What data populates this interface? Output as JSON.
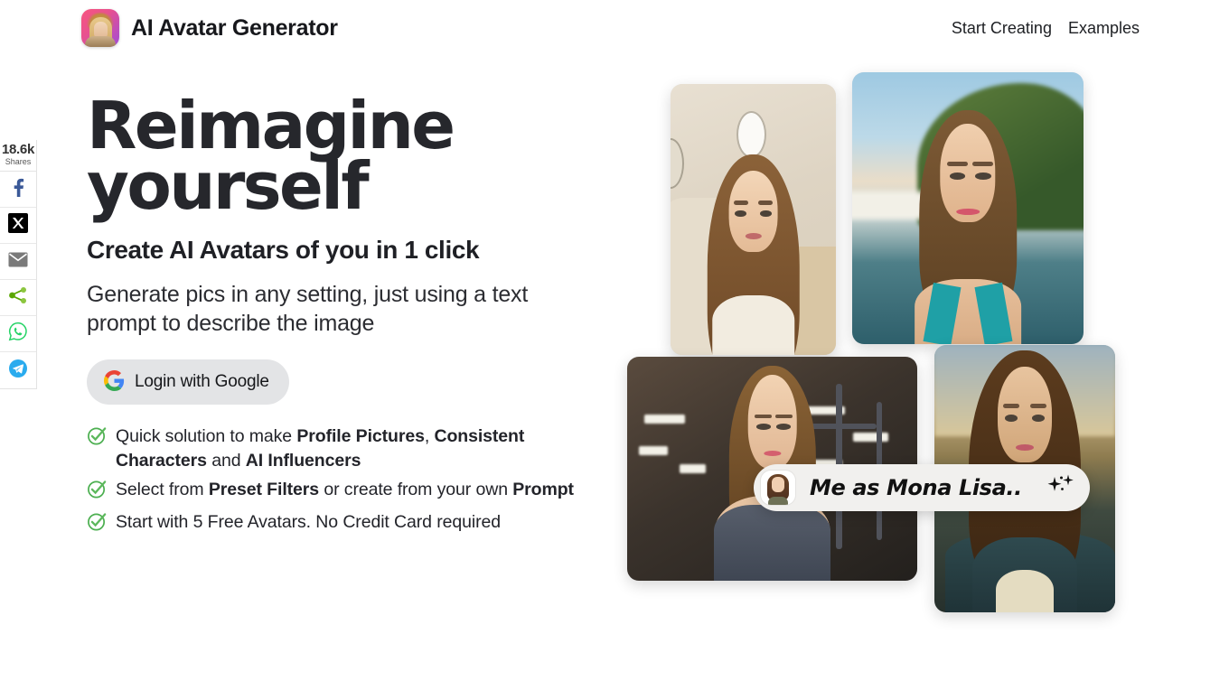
{
  "header": {
    "brand_title": "AI Avatar Generator",
    "logo_icon": "avatar-logo-icon",
    "nav": [
      {
        "label": "Start Creating",
        "name": "nav-start-creating"
      },
      {
        "label": "Examples",
        "name": "nav-examples"
      }
    ]
  },
  "share_rail": {
    "count": "18.6k",
    "count_label": "Shares",
    "buttons": [
      {
        "name": "facebook-icon",
        "label": "Facebook",
        "color": "#3b5998"
      },
      {
        "name": "x-twitter-icon",
        "label": "X",
        "color": "#000000"
      },
      {
        "name": "email-icon",
        "label": "Email",
        "color": "#7a7a7a"
      },
      {
        "name": "share-icon",
        "label": "Share",
        "color": "#7ac143"
      },
      {
        "name": "whatsapp-icon",
        "label": "WhatsApp",
        "color": "#25d366"
      },
      {
        "name": "telegram-icon",
        "label": "Telegram",
        "color": "#2aabee"
      }
    ]
  },
  "hero": {
    "headline": "Reimagine yourself",
    "subheadline": "Create AI Avatars of you in 1 click",
    "description": "Generate pics in any setting, just using a text prompt to describe the image",
    "login_button": {
      "label": "Login with Google",
      "icon": "google-icon"
    },
    "bullets": [
      {
        "icon": "green-check-circle-icon",
        "segments": [
          {
            "text": "Quick solution to make ",
            "bold": false
          },
          {
            "text": "Profile Pictures",
            "bold": true
          },
          {
            "text": ", ",
            "bold": false
          },
          {
            "text": "Consistent Characters",
            "bold": true
          },
          {
            "text": " and ",
            "bold": false
          },
          {
            "text": "AI Influencers",
            "bold": true
          }
        ]
      },
      {
        "icon": "green-check-circle-icon",
        "segments": [
          {
            "text": "Select from ",
            "bold": false
          },
          {
            "text": "Preset Filters",
            "bold": true
          },
          {
            "text": " or create from your own ",
            "bold": false
          },
          {
            "text": "Prompt",
            "bold": true
          }
        ]
      },
      {
        "icon": "green-check-circle-icon",
        "segments": [
          {
            "text": "Start with 5 Free Avatars. No Credit Card required",
            "bold": false
          }
        ]
      }
    ]
  },
  "collage": {
    "photos": [
      {
        "name": "photo-private-jet",
        "caption": "Woman in cream sweater seated in private jet cabin"
      },
      {
        "name": "photo-beach",
        "caption": "Woman in teal bikini on tropical beach with green hills"
      },
      {
        "name": "photo-gym",
        "caption": "Woman in grey sports bra in a dark gym"
      },
      {
        "name": "photo-mona-lisa",
        "caption": "Woman as Mona Lisa renaissance painting"
      }
    ]
  },
  "prompt_pill": {
    "text": "Me as Mona Lisa..",
    "avatar_icon": "user-avatar-thumbnail",
    "sparkle_icon": "sparkle-icon"
  },
  "colors": {
    "accent_pink": "#f7557f",
    "accent_purple": "#a04bd8",
    "check_green": "#4caf50",
    "text_dark": "#26272c",
    "button_gray": "#e3e4e6",
    "pill_bg": "#f1f0ee"
  }
}
